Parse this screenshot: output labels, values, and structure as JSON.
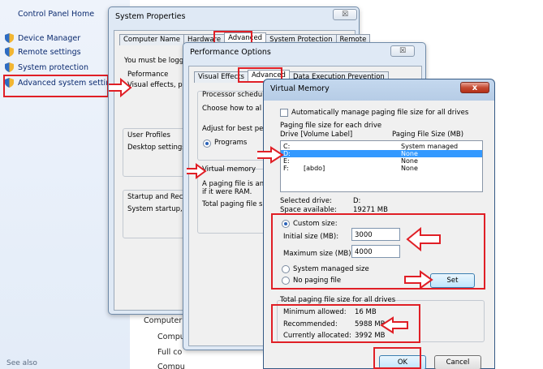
{
  "sidebar": {
    "home": "Control Panel Home",
    "links": [
      {
        "label": "Device Manager",
        "icon": "shield-icon"
      },
      {
        "label": "Remote settings",
        "icon": "shield-icon"
      },
      {
        "label": "System protection",
        "icon": "shield-icon"
      },
      {
        "label": "Advanced system settings",
        "icon": "shield-icon"
      }
    ],
    "see_also": "See also"
  },
  "background_text": {
    "computer": "Computer",
    "compu": "Compu",
    "full": "Full co",
    "compu2": "Compu"
  },
  "system_properties": {
    "title": "System Properties",
    "close": "☒",
    "tabs": [
      "Computer Name",
      "Hardware",
      "Advanced",
      "System Protection",
      "Remote"
    ],
    "must_be": "You must be logg",
    "performance": "Peformance",
    "performance_desc": "Visual effects, pr",
    "user_profiles": "User Profiles",
    "user_profiles_desc": "Desktop settings",
    "startup": "Startup and Rec",
    "startup_desc": "System startup, s"
  },
  "performance_options": {
    "title": "Performance Options",
    "close": "☒",
    "tabs": [
      "Visual Effects",
      "Advanced",
      "Data Execution Prevention"
    ],
    "processor": "Processor schedul",
    "choose": "Choose how to al",
    "adjust": "Adjust for best pe",
    "programs": "Programs",
    "virtual_memory": "Virtual memory",
    "vm_desc_1": "A paging file is an",
    "vm_desc_2": "if it were RAM.",
    "total": "Total paging file si"
  },
  "virtual_memory": {
    "title": "Virtual Memory",
    "close": "x",
    "auto_manage": "Automatically manage paging file size for all drives",
    "paging_each": "Paging file size for each drive",
    "col_drive": "Drive  [Volume Label]",
    "col_size": "Paging File Size (MB)",
    "drives": [
      {
        "drive": "C:",
        "label": "",
        "size": "System managed",
        "selected": false
      },
      {
        "drive": "D:",
        "label": "",
        "size": "None",
        "selected": true
      },
      {
        "drive": "E:",
        "label": "",
        "size": "None",
        "selected": false
      },
      {
        "drive": "F:",
        "label": "[abdo]",
        "size": "None",
        "selected": false
      }
    ],
    "selected_drive_label": "Selected drive:",
    "selected_drive_value": "D:",
    "space_label": "Space available:",
    "space_value": "19271 MB",
    "custom_size": "Custom size:",
    "initial_label": "Initial size (MB):",
    "initial_value": "3000",
    "max_label": "Maximum size (MB):",
    "max_value": "4000",
    "system_managed": "System managed size",
    "no_paging": "No paging file",
    "set": "Set",
    "total_label": "Total paging file size for all drives",
    "min_label": "Minimum allowed:",
    "min_value": "16 MB",
    "rec_label": "Recommended:",
    "rec_value": "5988 MB",
    "alloc_label": "Currently allocated:",
    "alloc_value": "3992 MB",
    "ok": "OK",
    "cancel": "Cancel"
  },
  "colors": {
    "annotation_red": "#e01f26",
    "selection_blue": "#3399ff",
    "link_blue": "#0b2a6f"
  }
}
